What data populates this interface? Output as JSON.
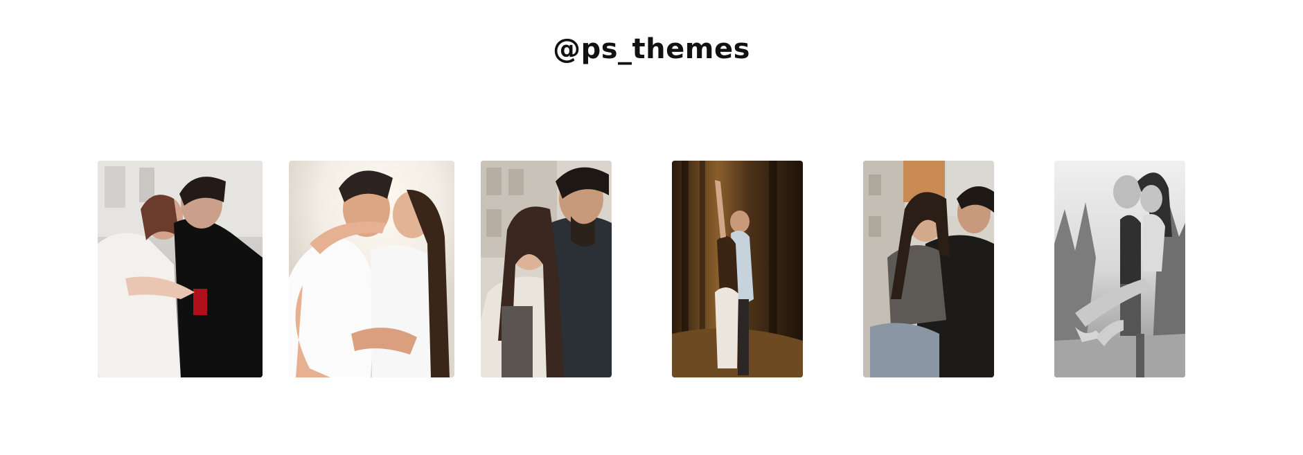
{
  "header": {
    "handle": "@ps_themes"
  },
  "gallery": {
    "items": [
      {
        "name": "couple-photo-1",
        "palette": [
          "#e9e7e4",
          "#f4f2ef",
          "#0d0d0d",
          "#6a3f32"
        ]
      },
      {
        "name": "couple-photo-2",
        "palette": [
          "#f7f2ea",
          "#ffffff",
          "#2b2220",
          "#d9a27f"
        ]
      },
      {
        "name": "couple-photo-3",
        "palette": [
          "#cfc9c0",
          "#e8e3da",
          "#2a2f35",
          "#3a2a24"
        ]
      },
      {
        "name": "couple-photo-4",
        "palette": [
          "#3b2612",
          "#a9793f",
          "#e9e2d8",
          "#1b120a"
        ]
      },
      {
        "name": "couple-photo-5",
        "palette": [
          "#d8d4cc",
          "#c98a54",
          "#1e1d1b",
          "#5d5a55"
        ]
      },
      {
        "name": "couple-photo-6",
        "palette": [
          "#e6e6e6",
          "#9a9a9a",
          "#2a2a2a",
          "#5c5c5c"
        ]
      }
    ]
  }
}
